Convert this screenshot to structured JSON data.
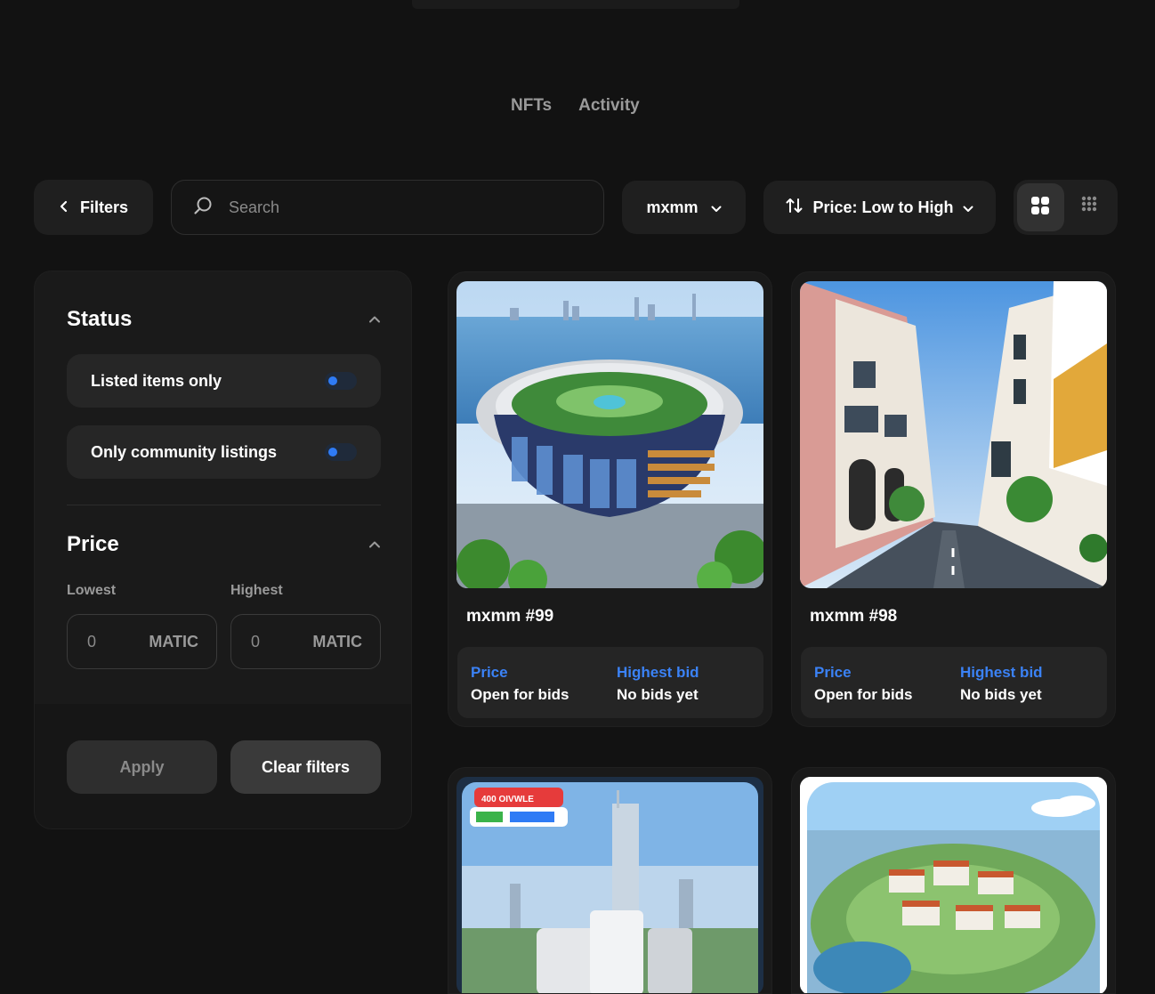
{
  "tabs": [
    "NFTs",
    "Activity"
  ],
  "toolbar": {
    "filters_label": "Filters",
    "search_placeholder": "Search",
    "collection_label": "mxmm",
    "sort_label": "Price: Low to High"
  },
  "sidebar": {
    "status": {
      "title": "Status",
      "toggles": [
        {
          "label": "Listed items only"
        },
        {
          "label": "Only community listings"
        }
      ]
    },
    "price": {
      "title": "Price",
      "lowest_label": "Lowest",
      "highest_label": "Highest",
      "lowest_placeholder": "0",
      "highest_placeholder": "0",
      "unit": "MATIC"
    },
    "apply_label": "Apply",
    "clear_label": "Clear filters"
  },
  "cards": [
    {
      "title": "mxmm #99",
      "price_label": "Price",
      "price_value": "Open for bids",
      "bid_label": "Highest bid",
      "bid_value": "No bids yet"
    },
    {
      "title": "mxmm #98",
      "price_label": "Price",
      "price_value": "Open for bids",
      "bid_label": "Highest bid",
      "bid_value": "No bids yet"
    },
    {
      "title": "",
      "price_label": "",
      "price_value": "",
      "bid_label": "",
      "bid_value": ""
    },
    {
      "title": "",
      "price_label": "",
      "price_value": "",
      "bid_label": "",
      "bid_value": ""
    }
  ],
  "colors": {
    "accent": "#2f7bf5",
    "label_blue": "#3b82f6",
    "bg": "#121212",
    "panel": "#1a1a1a"
  },
  "icons": [
    "chevron-left-icon",
    "search-icon",
    "chevron-down-icon",
    "sort-arrows-icon",
    "grid-large-icon",
    "grid-small-icon",
    "chevron-up-icon"
  ]
}
